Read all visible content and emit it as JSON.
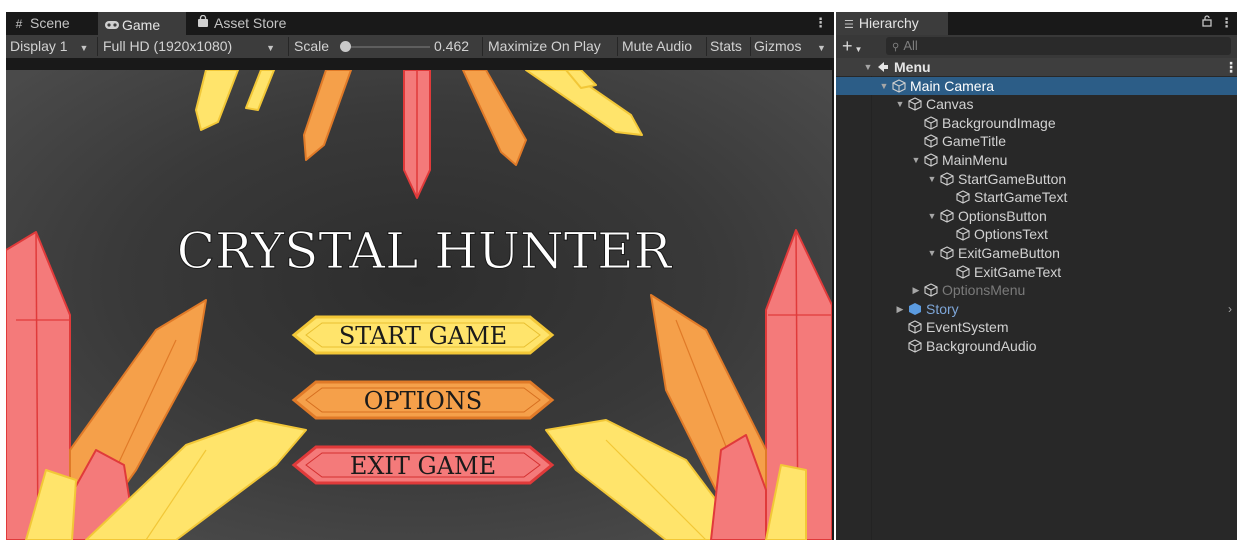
{
  "game_window": {
    "tabs": [
      {
        "label": "Scene",
        "icon": "hash-icon"
      },
      {
        "label": "Game",
        "icon": "gamepad-icon"
      },
      {
        "label": "Asset Store",
        "icon": "shopping-bag-icon"
      }
    ],
    "toolbar": {
      "display": "Display 1",
      "resolution": "Full HD (1920x1080)",
      "scale_label": "Scale",
      "scale_value": "0.462",
      "scale_fraction": 0.05,
      "maximize_on_play": "Maximize On Play",
      "mute_audio": "Mute Audio",
      "stats": "Stats",
      "gizmos": "Gizmos"
    },
    "game": {
      "title": "CRYSTAL HUNTER",
      "menu_buttons": [
        "START GAME",
        "OPTIONS",
        "EXIT GAME"
      ],
      "colors": {
        "background": "#3a3a3a",
        "yellow": "#ffe46b",
        "orange": "#f5a04a",
        "red": "#f47a7a"
      }
    }
  },
  "hierarchy": {
    "tab_label": "Hierarchy",
    "search_placeholder": "All",
    "items": [
      {
        "label": "Menu",
        "type": "scene",
        "expanded": true
      },
      {
        "label": "Main Camera",
        "selected": true,
        "expanded": true
      },
      {
        "label": "Canvas",
        "expanded": true
      },
      {
        "label": "BackgroundImage"
      },
      {
        "label": "GameTitle"
      },
      {
        "label": "MainMenu",
        "expanded": true
      },
      {
        "label": "StartGameButton",
        "expanded": true
      },
      {
        "label": "StartGameText"
      },
      {
        "label": "OptionsButton",
        "expanded": true
      },
      {
        "label": "OptionsText"
      },
      {
        "label": "ExitGameButton",
        "expanded": true
      },
      {
        "label": "ExitGameText"
      },
      {
        "label": "OptionsMenu",
        "state": "disabled",
        "expanded": false
      },
      {
        "label": "Story",
        "state": "prefab",
        "expanded": false
      },
      {
        "label": "EventSystem"
      },
      {
        "label": "BackgroundAudio"
      }
    ]
  }
}
